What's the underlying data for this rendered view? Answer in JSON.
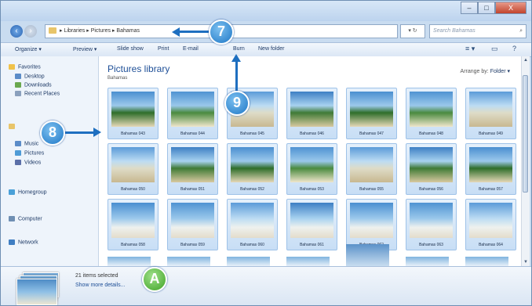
{
  "window": {
    "buttons": {
      "minimize": "–",
      "maximize": "□",
      "close": "X"
    }
  },
  "address": {
    "path": "▸ Libraries ▸ Pictures ▸ Bahamas",
    "refresh": "▾ ↻",
    "search_placeholder": "Search Bahamas",
    "search_icon": "⌕"
  },
  "toolbar": {
    "organize": "Organize ▾",
    "preview": "Preview ▾",
    "slideshow": "Slide show",
    "print": "Print",
    "email": "E-mail",
    "burn": "Burn",
    "new_folder": "New folder",
    "views_icon": "≡ ▾",
    "pane_icon": "▭",
    "help_icon": "?"
  },
  "nav_pane": {
    "favorites": "Favorites",
    "favorites_items": [
      "Desktop",
      "Downloads",
      "Recent Places"
    ],
    "libraries_items": [
      "Music",
      "Pictures",
      "Videos"
    ],
    "homegroup": "Homegroup",
    "computer": "Computer",
    "network": "Network"
  },
  "content": {
    "title": "Pictures library",
    "subtitle": "Bahamas",
    "arrange_label": "Arrange by:",
    "arrange_value": "Folder ▾",
    "thumbnails": [
      {
        "caption": "Bahamas 043"
      },
      {
        "caption": "Bahamas 044"
      },
      {
        "caption": "Bahamas 045"
      },
      {
        "caption": "Bahamas 046"
      },
      {
        "caption": "Bahamas 047"
      },
      {
        "caption": "Bahamas 048"
      },
      {
        "caption": "Bahamas 049"
      },
      {
        "caption": "Bahamas 050"
      },
      {
        "caption": "Bahamas 051"
      },
      {
        "caption": "Bahamas 052"
      },
      {
        "caption": "Bahamas 053"
      },
      {
        "caption": "Bahamas 055"
      },
      {
        "caption": "Bahamas 056"
      },
      {
        "caption": "Bahamas 057"
      },
      {
        "caption": "Bahamas 058"
      },
      {
        "caption": "Bahamas 059"
      },
      {
        "caption": "Bahamas 060"
      },
      {
        "caption": "Bahamas 061"
      },
      {
        "caption": "Bahamas 062"
      },
      {
        "caption": "Bahamas 063"
      },
      {
        "caption": "Bahamas 064"
      }
    ]
  },
  "details": {
    "selected": "21 items selected",
    "show_more": "Show more details..."
  },
  "callouts": {
    "c7": "7",
    "c8": "8",
    "c9": "9",
    "cA": "A"
  },
  "colors": {
    "callout_blue": "#1e77c6",
    "callout_green": "#3ea326",
    "link": "#1e4f97"
  }
}
